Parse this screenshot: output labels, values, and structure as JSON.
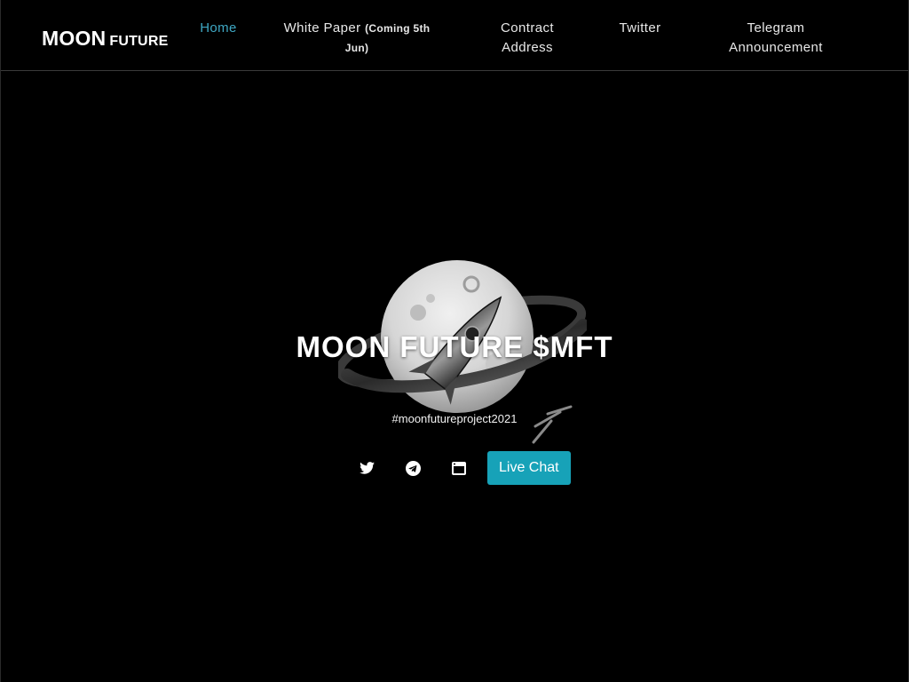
{
  "brand": {
    "main": "MOON",
    "sub": "FUTURE"
  },
  "nav": {
    "home": "Home",
    "white_paper": "White Paper",
    "white_paper_note": "(Coming 5th Jun)",
    "contract": "Contract Address",
    "twitter": "Twitter",
    "telegram": "Telegram Announcement"
  },
  "hero": {
    "title": "MOON FUTURE $MFT",
    "subtitle": "#moonfutureproject2021"
  },
  "social": {
    "twitter_icon": "twitter-bird-icon",
    "telegram_icon": "telegram-plane-icon",
    "website_icon": "browser-window-icon",
    "live_chat": "Live Chat"
  },
  "colors": {
    "background": "#000000",
    "nav_active": "#3fa8c4",
    "live_chat_button": "#17a2b8"
  }
}
